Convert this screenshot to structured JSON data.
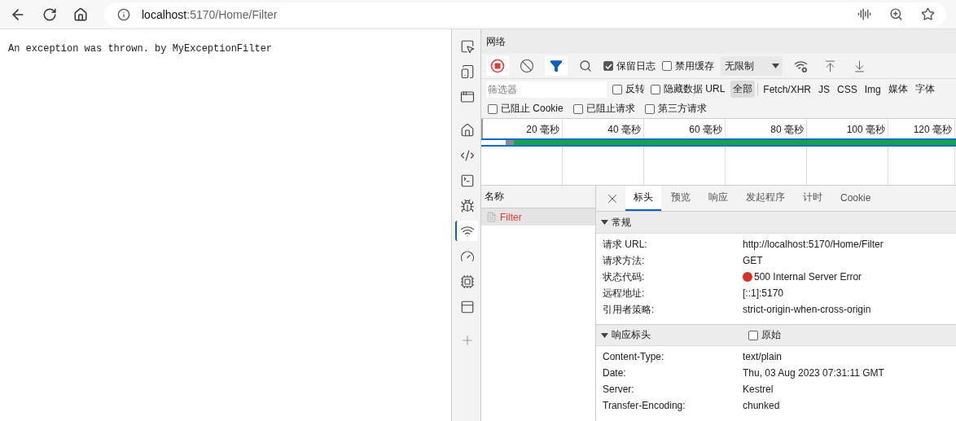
{
  "browser": {
    "url_host": "localhost",
    "url_path": ":5170/Home/Filter"
  },
  "page": {
    "message": "An exception was thrown. by MyExceptionFilter"
  },
  "devtools": {
    "activity_bar": [
      {
        "kind": "inspect",
        "selected": false
      },
      {
        "kind": "device",
        "selected": false
      },
      {
        "kind": "window",
        "selected": false
      },
      {
        "kind": "home",
        "selected": false
      },
      {
        "kind": "elements",
        "selected": false
      },
      {
        "kind": "console",
        "selected": false
      },
      {
        "kind": "sources",
        "selected": false
      },
      {
        "kind": "network",
        "selected": true
      },
      {
        "kind": "performance",
        "selected": false
      },
      {
        "kind": "memory",
        "selected": false
      },
      {
        "kind": "application",
        "selected": false
      },
      {
        "kind": "more",
        "selected": false
      }
    ],
    "panel_title": "网络",
    "toolbar": {
      "recording": true,
      "filter_active": true,
      "checks": [
        {
          "label": "保留日志",
          "checked": true
        },
        {
          "label": "禁用缓存",
          "checked": false
        }
      ],
      "throttling": "无限制"
    },
    "filter": {
      "placeholder": "筛选器",
      "checks": [
        {
          "label": "反转",
          "checked": false
        },
        {
          "label": "隐藏数据 URL",
          "checked": false
        }
      ],
      "types": [
        {
          "label": "全部",
          "selected": true
        },
        {
          "label": "Fetch/XHR",
          "selected": false
        },
        {
          "label": "JS",
          "selected": false
        },
        {
          "label": "CSS",
          "selected": false
        },
        {
          "label": "Img",
          "selected": false
        },
        {
          "label": "媒体",
          "selected": false
        },
        {
          "label": "字体",
          "selected": false
        }
      ],
      "blocked_checks": [
        {
          "label": "已阻止 Cookie",
          "checked": false
        },
        {
          "label": "已阻止请求",
          "checked": false
        },
        {
          "label": "第三方请求",
          "checked": false
        }
      ]
    },
    "timeline": {
      "ticks": [
        "20  毫秒",
        "40  毫秒",
        "60  毫秒",
        "80  毫秒",
        "100  毫秒",
        "120  毫秒"
      ]
    },
    "requests": {
      "header": "名称",
      "items": [
        {
          "name": "Filter",
          "selected": true,
          "failed": true
        }
      ]
    },
    "details": {
      "tabs": [
        {
          "label": "标头",
          "selected": true
        },
        {
          "label": "预览",
          "selected": false
        },
        {
          "label": "响应",
          "selected": false
        },
        {
          "label": "发起程序",
          "selected": false
        },
        {
          "label": "计时",
          "selected": false
        },
        {
          "label": "Cookie",
          "selected": false
        }
      ],
      "sections": [
        {
          "title": "常规",
          "expanded": true,
          "rows": [
            {
              "name": "请求 URL:",
              "value": "http://localhost:5170/Home/Filter",
              "kind": "plain"
            },
            {
              "name": "请求方法:",
              "value": "GET",
              "kind": "plain"
            },
            {
              "name": "状态代码:",
              "value": "500 Internal Server Error",
              "kind": "status",
              "color": "#d93025"
            },
            {
              "name": "远程地址:",
              "value": "[::1]:5170",
              "kind": "plain"
            },
            {
              "name": "引用者策略:",
              "value": "strict-origin-when-cross-origin",
              "kind": "plain"
            }
          ]
        },
        {
          "title": "响应标头",
          "expanded": true,
          "toggle": {
            "label": "原始",
            "checked": false
          },
          "rows": [
            {
              "name": "Content-Type:",
              "value": "text/plain",
              "kind": "plain"
            },
            {
              "name": "Date:",
              "value": "Thu, 03 Aug 2023 07:31:11 GMT",
              "kind": "plain"
            },
            {
              "name": "Server:",
              "value": "Kestrel",
              "kind": "plain"
            },
            {
              "name": "Transfer-Encoding:",
              "value": "chunked",
              "kind": "plain"
            }
          ]
        }
      ]
    }
  }
}
